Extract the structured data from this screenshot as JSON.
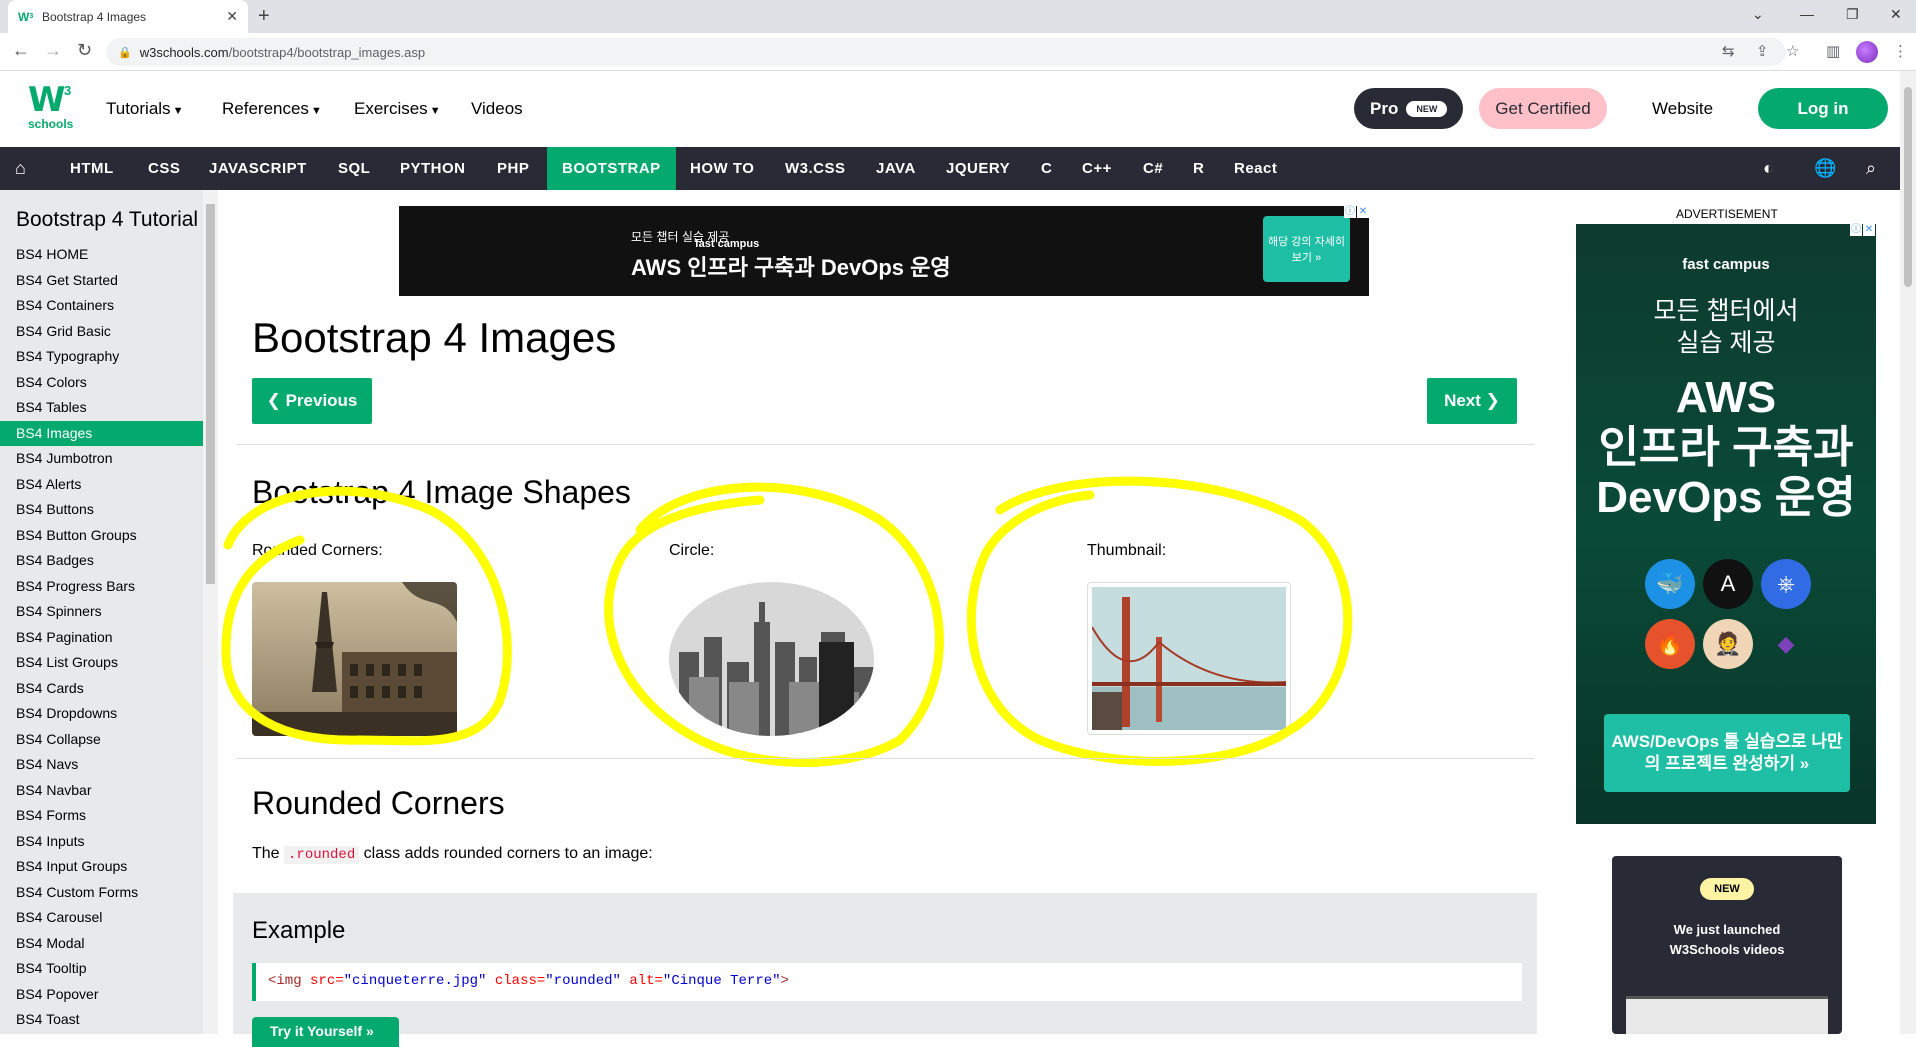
{
  "browser": {
    "tab_title": "Bootstrap 4 Images",
    "url_host": "w3schools.com",
    "url_path": "/bootstrap4/bootstrap_images.asp"
  },
  "header": {
    "logo_text": "W",
    "logo_sup": "3",
    "logo_schools": "schools",
    "menu": [
      "Tutorials",
      "References",
      "Exercises",
      "Videos"
    ],
    "pro_label": "Pro",
    "pro_badge": "NEW",
    "cert_label": "Get Certified",
    "website_label": "Website",
    "login_label": "Log in"
  },
  "topnav": {
    "items": [
      "HTML",
      "CSS",
      "JAVASCRIPT",
      "SQL",
      "PYTHON",
      "PHP",
      "BOOTSTRAP",
      "HOW TO",
      "W3.CSS",
      "JAVA",
      "JQUERY",
      "C",
      "C++",
      "C#",
      "R",
      "React"
    ],
    "active": "BOOTSTRAP"
  },
  "sidebar": {
    "title": "Bootstrap 4 Tutorial",
    "links": [
      "BS4 HOME",
      "BS4 Get Started",
      "BS4 Containers",
      "BS4 Grid Basic",
      "BS4 Typography",
      "BS4 Colors",
      "BS4 Tables",
      "BS4 Images",
      "BS4 Jumbotron",
      "BS4 Alerts",
      "BS4 Buttons",
      "BS4 Button Groups",
      "BS4 Badges",
      "BS4 Progress Bars",
      "BS4 Spinners",
      "BS4 Pagination",
      "BS4 List Groups",
      "BS4 Cards",
      "BS4 Dropdowns",
      "BS4 Collapse",
      "BS4 Navs",
      "BS4 Navbar",
      "BS4 Forms",
      "BS4 Inputs",
      "BS4 Input Groups",
      "BS4 Custom Forms",
      "BS4 Carousel",
      "BS4 Modal",
      "BS4 Tooltip",
      "BS4 Popover",
      "BS4 Toast"
    ],
    "active": "BS4 Images"
  },
  "ad_top": {
    "brand": "fast campus",
    "sub": "모든 챕터 실습 제공",
    "headline": "AWS 인프라 구축과 DevOps 운영",
    "cta": "해당 강의 자세히보기 »"
  },
  "main": {
    "title": "Bootstrap 4 Images",
    "prev_label": "❮ Previous",
    "next_label": "Next ❯",
    "shapes_heading": "Bootstrap 4 Image Shapes",
    "captions": [
      "Rounded Corners:",
      "Circle:",
      "Thumbnail:"
    ],
    "rounded_heading": "Rounded Corners",
    "para_before": "The ",
    "para_code": ".rounded",
    "para_after": " class adds rounded corners to an image:",
    "example_heading": "Example",
    "code": {
      "open": "<img ",
      "attr1": "src=",
      "val1": "\"cinqueterre.jpg\"",
      "attr2": "class=",
      "val2": "\"rounded\"",
      "attr3": "alt=",
      "val3": "\"Cinque Terre\"",
      "close": ">"
    },
    "tryit_label": "Try it Yourself »"
  },
  "ad_right": {
    "label": "ADVERTISEMENT",
    "brand": "fast campus",
    "line1": "모든 챕터에서",
    "line1b": "실습 제공",
    "line2a": "AWS",
    "line2b": "인프라 구축과",
    "line2c": "DevOps 운영",
    "cta": "AWS/DevOps 툴 실습으로 나만의 프로젝트 완성하기 »"
  },
  "video_card": {
    "badge": "NEW",
    "text1": "We just launched",
    "text2": "W3Schools videos"
  },
  "colors": {
    "accent": "#04aa6d",
    "topnav": "#282a35",
    "highlight_annotation": "#ffff00"
  }
}
